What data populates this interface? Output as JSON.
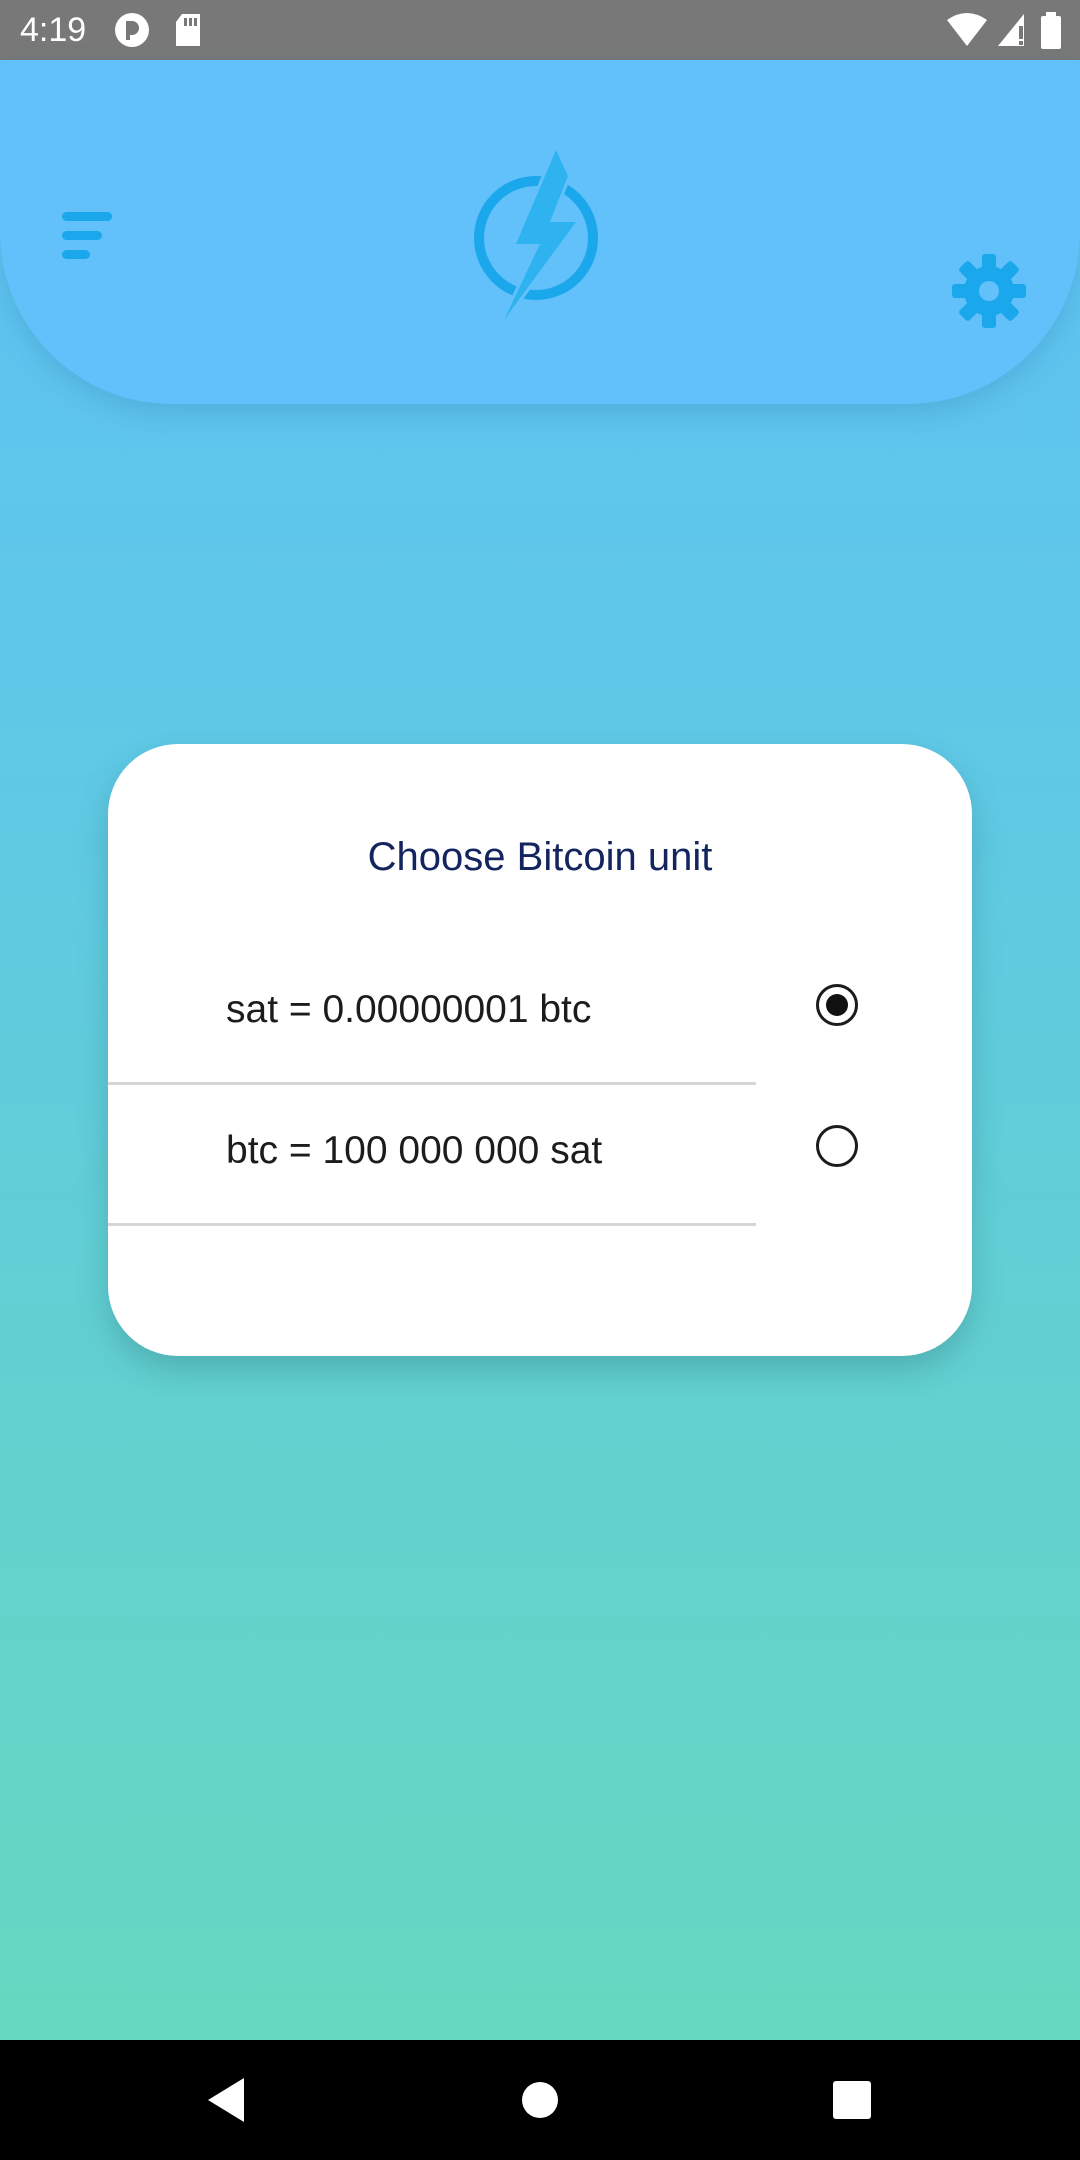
{
  "status_bar": {
    "time": "4:19",
    "icons": [
      "privacy-indicator-icon",
      "sd-card-icon",
      "wifi-icon",
      "signal-icon",
      "battery-icon"
    ]
  },
  "header": {
    "menu_icon": "menu-lines-icon",
    "logo_icon": "lightning-bolt-logo-icon",
    "settings_icon": "gear-icon",
    "accent_color": "#1aa7ec"
  },
  "dialog": {
    "title": "Choose Bitcoin unit",
    "options": [
      {
        "label": "sat = 0.00000001 btc",
        "selected": true
      },
      {
        "label": "btc = 100 000 000 sat",
        "selected": false
      }
    ]
  },
  "nav_bar": {
    "icons": [
      "back-icon",
      "home-icon",
      "recents-icon"
    ]
  },
  "colors": {
    "title": "#13245e",
    "header": "#62c1fa",
    "gradient_top": "#5ec0f6",
    "gradient_bottom": "#66d9bd"
  }
}
